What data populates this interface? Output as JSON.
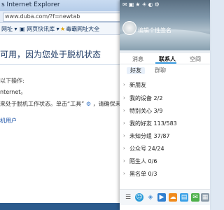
{
  "browser": {
    "title": "s Internet Explorer",
    "url": "www.duba.com/?f=newtab",
    "favorites": [
      {
        "label": "网址",
        "icon": "ie-icon"
      },
      {
        "label": "网页快讯库",
        "icon": "web-slice-icon"
      },
      {
        "label": "毒霸网址大全",
        "icon": "star-icon"
      }
    ],
    "content": {
      "heading": "可用，因为您处于脱机状态",
      "lines": [
        "以下操作:",
        "nternet。",
        "来处于脱机工作状态。单击“工具”",
        "，请确保未选中"
      ],
      "link": "机用户"
    }
  },
  "qq": {
    "header_icons": [
      "mail-icon",
      "photo-icon",
      "zone-icon",
      "weather-icon",
      "skin-icon",
      "settings-icon"
    ],
    "nickname": "编辑个性签名",
    "tabs": [
      "消息",
      "联系人",
      "空间"
    ],
    "active_tab": "联系人",
    "subtabs": [
      "好友",
      "群聊"
    ],
    "active_subtab": "好友",
    "groups": [
      {
        "label": "新朋友"
      },
      {
        "label": "我的设备 2/2"
      },
      {
        "label": "特别关心 3/9"
      },
      {
        "label": "我的好友 113/583"
      },
      {
        "label": "未知分组 37/87"
      },
      {
        "label": "公众号 24/24"
      },
      {
        "label": "陌生人 0/6"
      },
      {
        "label": "黑名单 0/3"
      }
    ],
    "bottom_icons": [
      "menu-icon",
      "add-contact-icon",
      "app-icon",
      "tencent-video-icon",
      "weiyun-icon",
      "file-icon",
      "mail-icon",
      "app-manager-icon"
    ]
  }
}
